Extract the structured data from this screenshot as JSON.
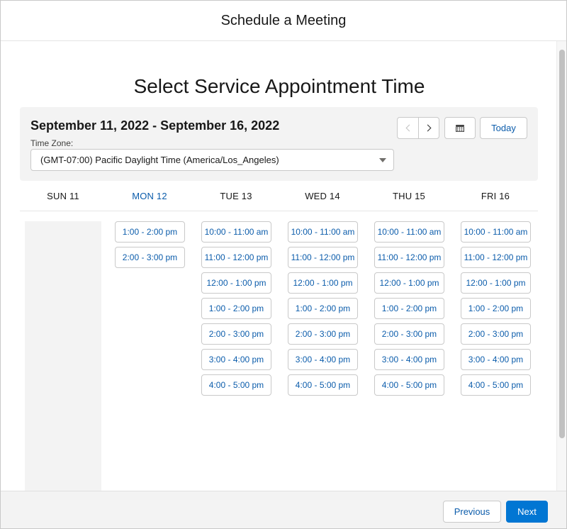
{
  "modal": {
    "title": "Schedule a Meeting"
  },
  "page": {
    "heading": "Select Service Appointment Time"
  },
  "toolbar": {
    "date_range": "September 11, 2022 - September 16, 2022",
    "timezone_label": "Time Zone:",
    "timezone_value": "(GMT-07:00) Pacific Daylight Time (America/Los_Angeles)",
    "today_label": "Today",
    "prev_week_icon": "chevron-left-icon",
    "next_week_icon": "chevron-right-icon",
    "calendar_icon": "calendar-icon"
  },
  "days": [
    {
      "label": "SUN 11",
      "is_today": false,
      "slots": []
    },
    {
      "label": "MON 12",
      "is_today": true,
      "slots": [
        "1:00 - 2:00 pm",
        "2:00 - 3:00 pm"
      ]
    },
    {
      "label": "TUE 13",
      "is_today": false,
      "slots": [
        "10:00 - 11:00 am",
        "11:00 - 12:00 pm",
        "12:00 - 1:00 pm",
        "1:00 - 2:00 pm",
        "2:00 - 3:00 pm",
        "3:00 - 4:00 pm",
        "4:00 - 5:00 pm"
      ]
    },
    {
      "label": "WED 14",
      "is_today": false,
      "slots": [
        "10:00 - 11:00 am",
        "11:00 - 12:00 pm",
        "12:00 - 1:00 pm",
        "1:00 - 2:00 pm",
        "2:00 - 3:00 pm",
        "3:00 - 4:00 pm",
        "4:00 - 5:00 pm"
      ]
    },
    {
      "label": "THU 15",
      "is_today": false,
      "slots": [
        "10:00 - 11:00 am",
        "11:00 - 12:00 pm",
        "12:00 - 1:00 pm",
        "1:00 - 2:00 pm",
        "2:00 - 3:00 pm",
        "3:00 - 4:00 pm",
        "4:00 - 5:00 pm"
      ]
    },
    {
      "label": "FRI 16",
      "is_today": false,
      "slots": [
        "10:00 - 11:00 am",
        "11:00 - 12:00 pm",
        "12:00 - 1:00 pm",
        "1:00 - 2:00 pm",
        "2:00 - 3:00 pm",
        "3:00 - 4:00 pm",
        "4:00 - 5:00 pm"
      ]
    }
  ],
  "footer": {
    "previous_label": "Previous",
    "next_label": "Next"
  },
  "colors": {
    "brand": "#0176d3",
    "link": "#0b5cab",
    "panel": "#f3f3f3",
    "border": "#c9c9c9"
  }
}
